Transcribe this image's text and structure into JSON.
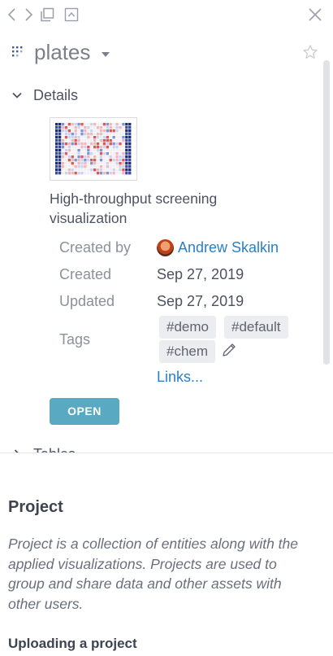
{
  "toolbar": {
    "icons": [
      "chevron-left-icon",
      "chevron-right-icon",
      "copy-window-icon",
      "collapse-up-icon",
      "close-icon"
    ]
  },
  "header": {
    "title": "plates",
    "star": "star-icon"
  },
  "details": {
    "section_label": "Details",
    "description": "High-throughput screening visualization",
    "created_by_label": "Created by",
    "created_by_value": "Andrew Skalkin",
    "created_label": "Created",
    "created_value": "Sep 27, 2019",
    "updated_label": "Updated",
    "updated_value": "Sep 27, 2019",
    "tags_label": "Tags",
    "tags": [
      "#demo",
      "#default",
      "#chem"
    ],
    "links_label": "Links...",
    "open_button": "OPEN"
  },
  "next_section": {
    "label": "Tables"
  },
  "help": {
    "title": "Project",
    "text": "Project is a collection of entities along with the applied visualizations. Projects are used to group and share data and other assets with other users.",
    "subtitle": "Uploading a project"
  },
  "colors": {
    "accent_button": "#5aa9c3",
    "link": "#2a7fc6"
  }
}
